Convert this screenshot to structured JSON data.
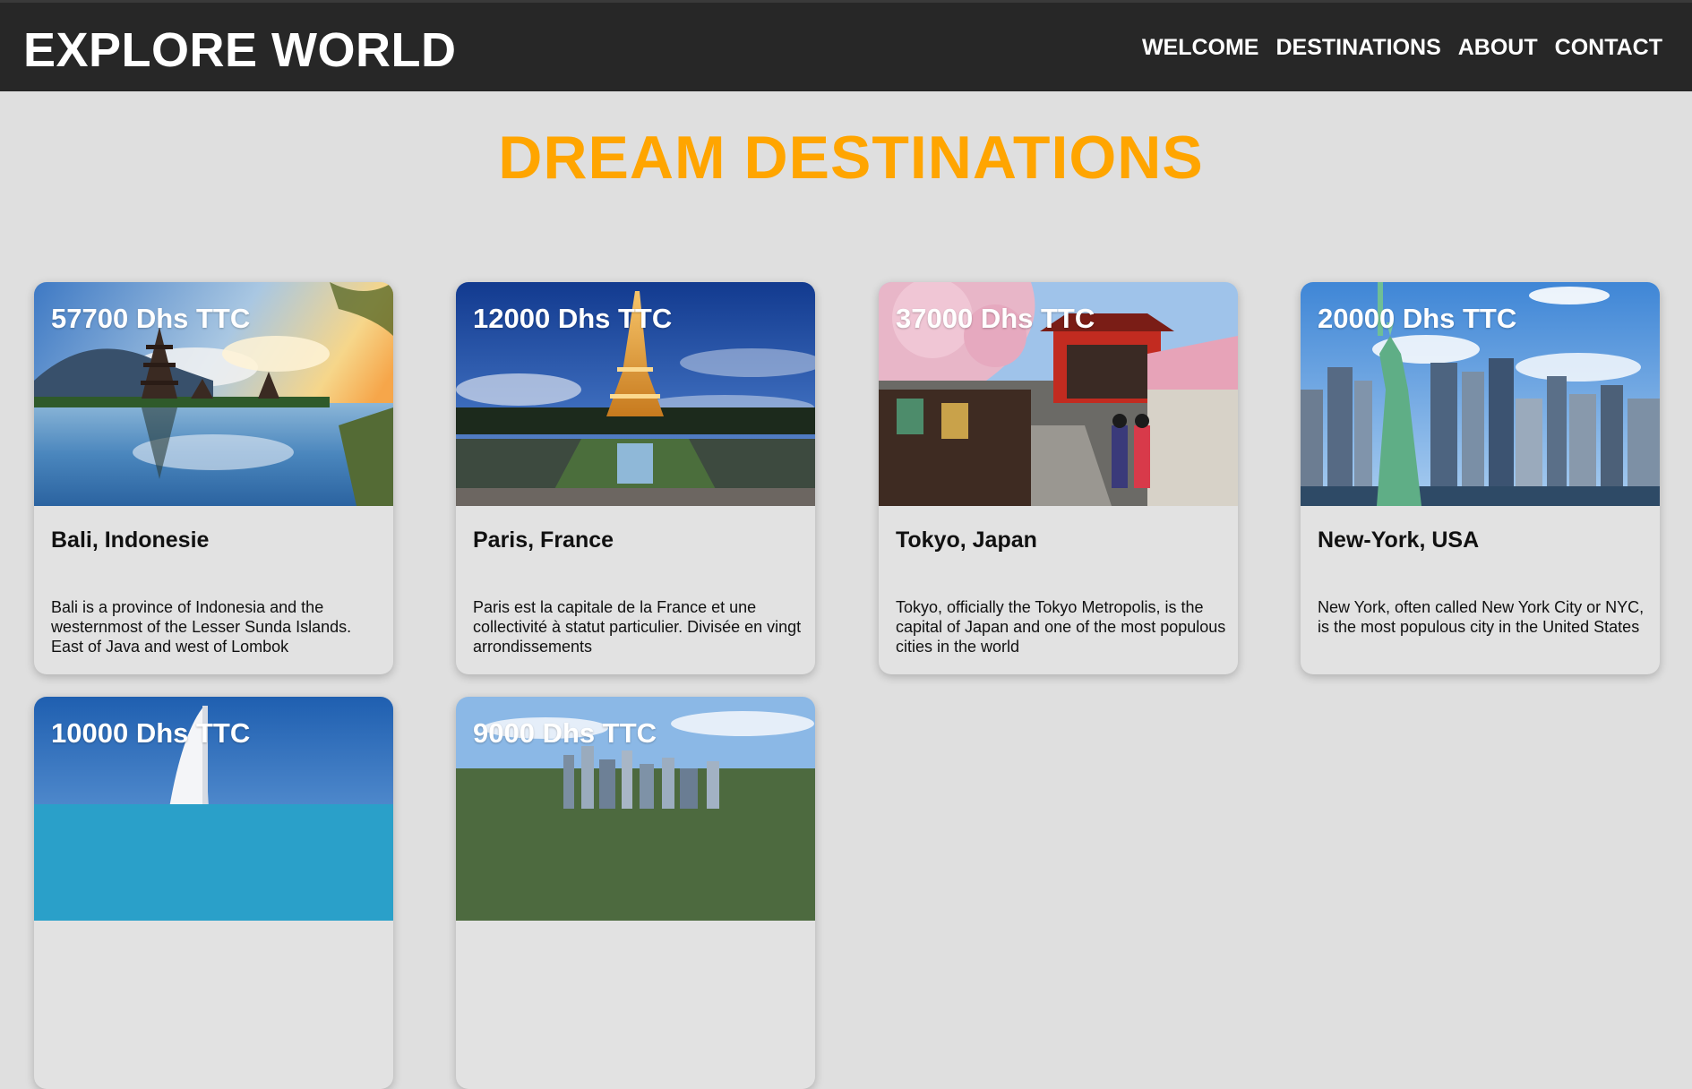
{
  "header": {
    "brand": "EXPLORE WORLD",
    "nav": [
      "WELCOME",
      "DESTINATIONS",
      "ABOUT",
      "CONTACT"
    ]
  },
  "main": {
    "title": "DREAM DESTINATIONS",
    "cards": [
      {
        "price": "57700 Dhs TTC",
        "city": "Bali, Indonesie",
        "description": "Bali is a province of Indonesia and the westernmost of the Lesser Sunda Islands. East of Java and west of Lombok",
        "image": "bali-temple-lake-photo"
      },
      {
        "price": "12000 Dhs TTC",
        "city": "Paris, France",
        "description": "Paris est la capitale de la France et une collectivité à statut particulier. Divisée en vingt arrondissements",
        "image": "paris-eiffel-tower-photo"
      },
      {
        "price": "37000 Dhs TTC",
        "city": "Tokyo, Japan",
        "description": "Tokyo, officially the Tokyo Metropolis, is the capital of Japan and one of the most populous cities in the world",
        "image": "tokyo-temple-cherry-blossom-photo"
      },
      {
        "price": "20000 Dhs TTC",
        "city": "New-York, USA",
        "description": "New York, often called New York City or NYC, is the most populous city in the United States",
        "image": "new-york-statue-of-liberty-photo"
      },
      {
        "price": "10000 Dhs TTC",
        "city": "",
        "description": "",
        "image": "dubai-burj-al-arab-photo"
      },
      {
        "price": "9000 Dhs TTC",
        "city": "",
        "description": "",
        "image": "city-skyline-photo"
      }
    ]
  },
  "colors": {
    "header_bg": "#272727",
    "page_bg": "#dfdfdf",
    "accent": "#ffa500",
    "card_bg": "#e2e2e2"
  }
}
